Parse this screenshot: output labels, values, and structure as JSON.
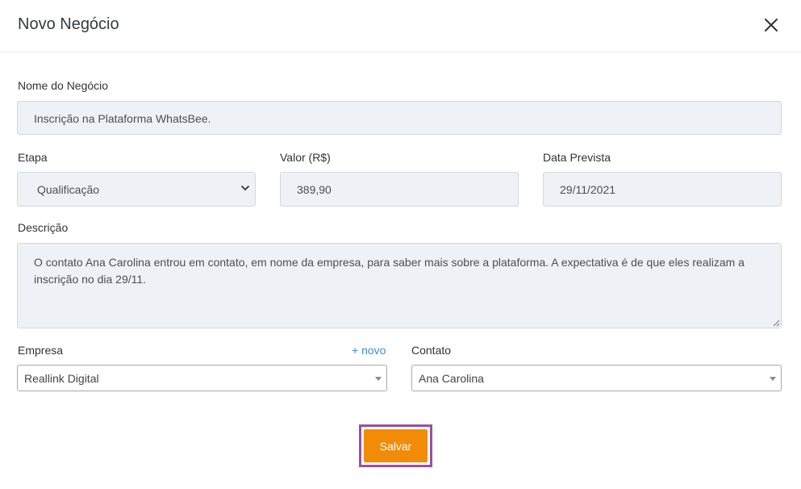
{
  "modal": {
    "title": "Novo Negócio"
  },
  "form": {
    "name_label": "Nome do Negócio",
    "name_value": "Inscrição na Plataforma WhatsBee.",
    "stage_label": "Etapa",
    "stage_value": "Qualificação",
    "value_label": "Valor (R$)",
    "value_value": "389,90",
    "date_label": "Data Prevista",
    "date_value": "29/11/2021",
    "description_label": "Descrição",
    "description_value": "O contato Ana Carolina entrou em contato, em nome da empresa, para saber mais sobre a plataforma. A expectativa é de que eles realizam a inscrição no dia 29/11.",
    "company_label": "Empresa",
    "company_new_link": "+ novo",
    "company_value": "Reallink Digital",
    "contact_label": "Contato",
    "contact_value": "Ana Carolina"
  },
  "actions": {
    "save_label": "Salvar"
  },
  "colors": {
    "accent": "#f28c08",
    "highlight": "#9b4fa3",
    "link": "#3a8fd8"
  },
  "icons": {
    "close": "close-icon",
    "select": "chevron-down-icon",
    "dropdown": "caret-down-icon",
    "resize": "resize-handle-icon"
  }
}
